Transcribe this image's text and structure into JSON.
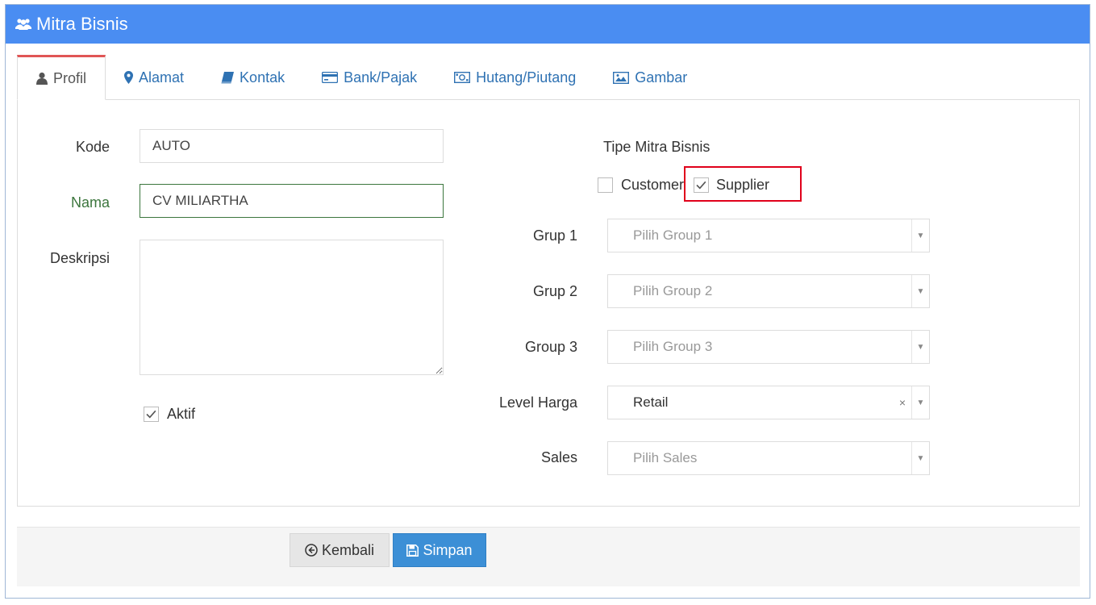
{
  "window": {
    "title": "Mitra Bisnis"
  },
  "tabs": [
    {
      "label": "Profil",
      "icon": "user-icon",
      "active": true
    },
    {
      "label": "Alamat",
      "icon": "map-marker-icon"
    },
    {
      "label": "Kontak",
      "icon": "book-icon"
    },
    {
      "label": "Bank/Pajak",
      "icon": "credit-card-icon"
    },
    {
      "label": "Hutang/Piutang",
      "icon": "money-icon"
    },
    {
      "label": "Gambar",
      "icon": "picture-icon"
    }
  ],
  "form": {
    "kode": {
      "label": "Kode",
      "value": "AUTO"
    },
    "nama": {
      "label": "Nama",
      "value": "CV MILIARTHA"
    },
    "deskripsi": {
      "label": "Deskripsi",
      "value": ""
    },
    "aktif": {
      "label": "Aktif",
      "checked": true
    },
    "tipe": {
      "label": "Tipe Mitra Bisnis",
      "customer": {
        "label": "Customer",
        "checked": false
      },
      "supplier": {
        "label": "Supplier",
        "checked": true
      }
    },
    "group1": {
      "label": "Grup 1",
      "placeholder": "Pilih Group 1"
    },
    "group2": {
      "label": "Grup 2",
      "placeholder": "Pilih Group 2"
    },
    "group3": {
      "label": "Group 3",
      "placeholder": "Pilih Group 3"
    },
    "level_harga": {
      "label": "Level Harga",
      "value": "Retail",
      "clear": "×"
    },
    "sales": {
      "label": "Sales",
      "placeholder": "Pilih Sales"
    }
  },
  "footer": {
    "back_label": "Kembali",
    "save_label": "Simpan"
  },
  "colors": {
    "titlebar": "#4a8df2",
    "save": "#3c8fd6",
    "highlight": "#e0001b",
    "active_tab": "#e05555"
  }
}
